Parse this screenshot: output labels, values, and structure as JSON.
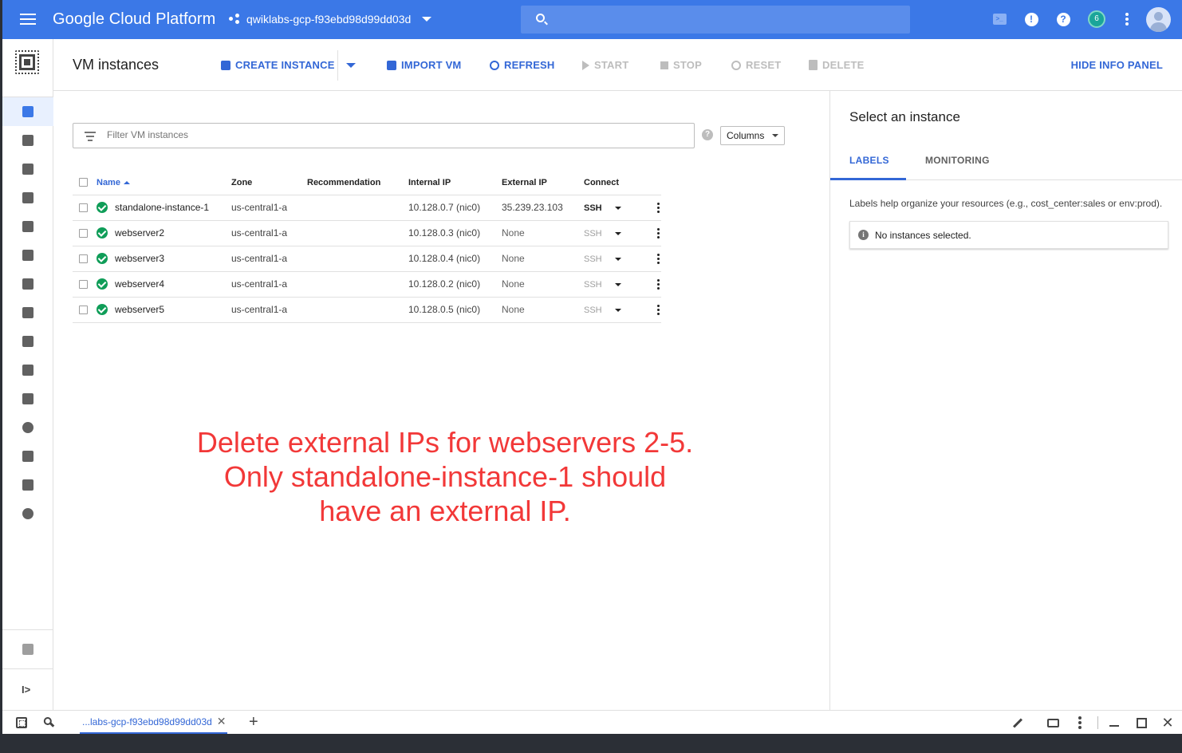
{
  "topbar": {
    "brand": "Google Cloud Platform",
    "project": "qwiklabs-gcp-f93ebd98d99dd03d",
    "search_placeholder": "",
    "notification_count": "6",
    "icons": [
      "menu-icon",
      "project-icon",
      "search-icon",
      "cloud-shell-icon",
      "feedback-icon",
      "help-icon",
      "notifications-icon",
      "more-icon",
      "account-icon"
    ],
    "bar_color": "#3b78e7"
  },
  "leftnav": {
    "product_icon": "compute-engine-icon",
    "items": [
      {
        "icon": "vm-instances-icon",
        "active": true
      },
      {
        "icon": "instance-groups-icon",
        "active": false
      },
      {
        "icon": "instance-templates-icon",
        "active": false
      },
      {
        "icon": "sole-tenant-nodes-icon",
        "active": false
      },
      {
        "icon": "machine-images-icon",
        "active": false
      },
      {
        "icon": "tpus-icon",
        "active": false
      },
      {
        "icon": "migrate-icon",
        "active": false
      },
      {
        "icon": "committed-use-discounts-icon",
        "active": false
      },
      {
        "icon": "metadata-icon",
        "active": false
      },
      {
        "icon": "health-checks-icon",
        "active": false
      },
      {
        "icon": "zones-icon",
        "active": false
      },
      {
        "icon": "operations-icon",
        "active": false
      },
      {
        "icon": "quotas-icon",
        "active": false
      },
      {
        "icon": "security-scans-icon",
        "active": false
      },
      {
        "icon": "settings-icon",
        "active": false
      }
    ],
    "marketplace_icon": "marketplace-icon",
    "expand_icon": "expand-icon",
    "expand_label": "I>"
  },
  "toolbar": {
    "title": "VM instances",
    "create_label": "CREATE INSTANCE",
    "import_label": "IMPORT VM",
    "refresh_label": "REFRESH",
    "start_label": "START",
    "stop_label": "STOP",
    "reset_label": "RESET",
    "delete_label": "DELETE",
    "hide_info_label": "HIDE INFO PANEL"
  },
  "filter": {
    "placeholder": "Filter VM instances",
    "help_label": "?",
    "columns_label": "Columns"
  },
  "table": {
    "headers": {
      "name": "Name",
      "zone": "Zone",
      "recommendation": "Recommendation",
      "internal_ip": "Internal IP",
      "external_ip": "External IP",
      "connect": "Connect"
    },
    "rows": [
      {
        "name": "standalone-instance-1",
        "zone": "us-central1-a",
        "recommendation": "",
        "internal_ip": "10.128.0.7 (nic0)",
        "external_ip": "35.239.23.103",
        "connect": "SSH",
        "status": "running"
      },
      {
        "name": "webserver2",
        "zone": "us-central1-a",
        "recommendation": "",
        "internal_ip": "10.128.0.3 (nic0)",
        "external_ip": "None",
        "connect": "SSH",
        "status": "running"
      },
      {
        "name": "webserver3",
        "zone": "us-central1-a",
        "recommendation": "",
        "internal_ip": "10.128.0.4 (nic0)",
        "external_ip": "None",
        "connect": "SSH",
        "status": "running"
      },
      {
        "name": "webserver4",
        "zone": "us-central1-a",
        "recommendation": "",
        "internal_ip": "10.128.0.2 (nic0)",
        "external_ip": "None",
        "connect": "SSH",
        "status": "running"
      },
      {
        "name": "webserver5",
        "zone": "us-central1-a",
        "recommendation": "",
        "internal_ip": "10.128.0.5 (nic0)",
        "external_ip": "None",
        "connect": "SSH",
        "status": "running"
      }
    ]
  },
  "annotation": {
    "text": "Delete external IPs for webservers 2-5. Only standalone-instance-1 should have an external IP.",
    "color": "#f23838"
  },
  "info_panel": {
    "title": "Select an instance",
    "tabs": [
      "LABELS",
      "MONITORING"
    ],
    "description": "Labels help organize your resources (e.g., cost_center:sales or env:prod).",
    "info_icon": "i",
    "empty_message": "No instances selected."
  },
  "shellbar": {
    "tab_label": "...labs-gcp-f93ebd98d99dd03d",
    "close_label": "✕",
    "add_label": "+",
    "icons": [
      "grid-icon",
      "wrench-icon",
      "edit-icon",
      "web-preview-icon",
      "more-icon",
      "minimize-icon",
      "open-new-window-icon",
      "close-icon"
    ],
    "close_window_label": "✕"
  }
}
